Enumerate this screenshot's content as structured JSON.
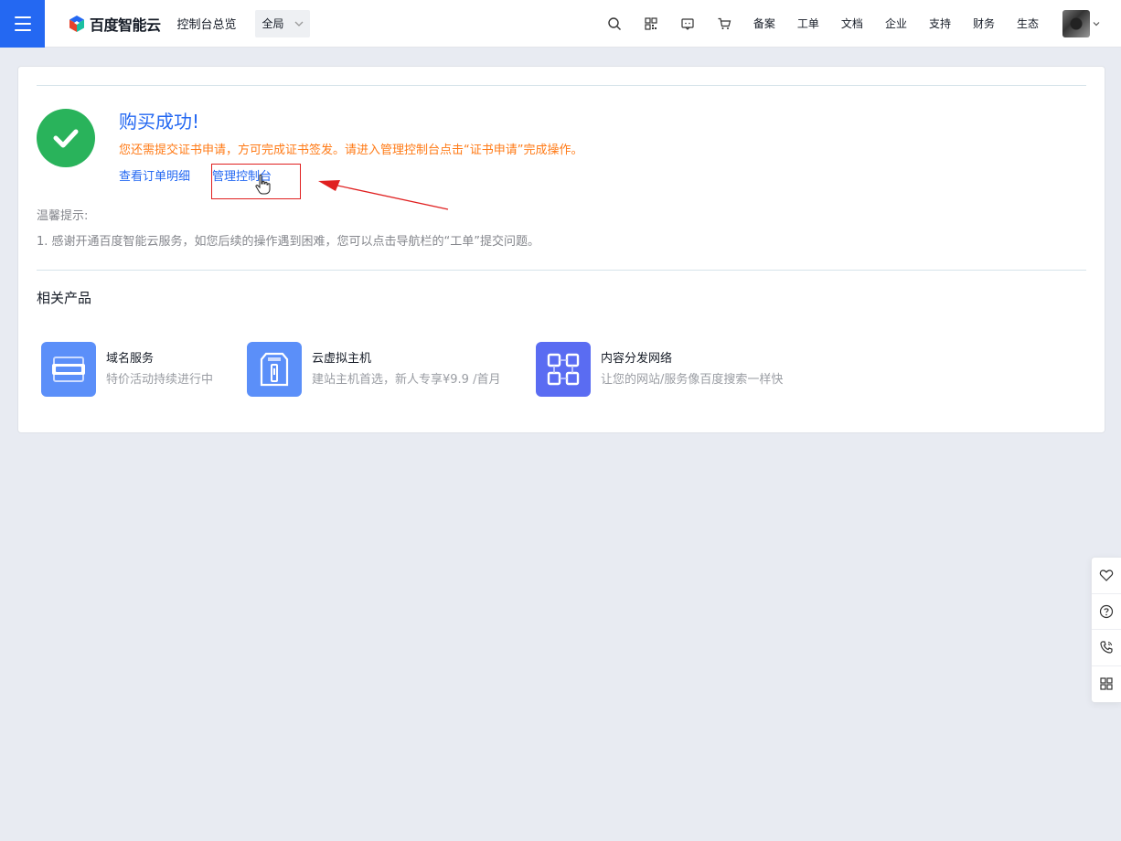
{
  "header": {
    "brand_name": "百度智能云",
    "console_title": "控制台总览",
    "region": "全局",
    "nav_links": [
      "备案",
      "工单",
      "文档",
      "企业",
      "支持",
      "财务",
      "生态"
    ]
  },
  "result": {
    "title": "购买成功!",
    "note": "您还需提交证书申请，方可完成证书签发。请进入管理控制台点击“证书申请”完成操作。",
    "view_order_link": "查看订单明细",
    "manage_console_link": "管理控制台"
  },
  "tips": {
    "label": "温馨提示:",
    "items": [
      "1. 感谢开通百度智能云服务，如您后续的操作遇到困难，您可以点击导航栏的“工单”提交问题。"
    ]
  },
  "related": {
    "title": "相关产品",
    "products": [
      {
        "name": "域名服务",
        "desc": "特价活动持续进行中",
        "icon": "domain-icon",
        "color": "#5b8ff9"
      },
      {
        "name": "云虚拟主机",
        "desc": "建站主机首选，新人专享¥9.9 /首月",
        "icon": "virtual-host-icon",
        "color": "#5b8ff9"
      },
      {
        "name": "内容分发网络",
        "desc": "让您的网站/服务像百度搜索一样快",
        "icon": "cdn-icon",
        "color": "#5a6cf2"
      }
    ]
  },
  "float_tools": [
    "heart-icon",
    "help-icon",
    "phone-icon",
    "apps-icon"
  ],
  "colors": {
    "accent": "#2468f2",
    "success": "#29b35b",
    "warning": "#ff7a16",
    "annotation": "#e02020"
  }
}
